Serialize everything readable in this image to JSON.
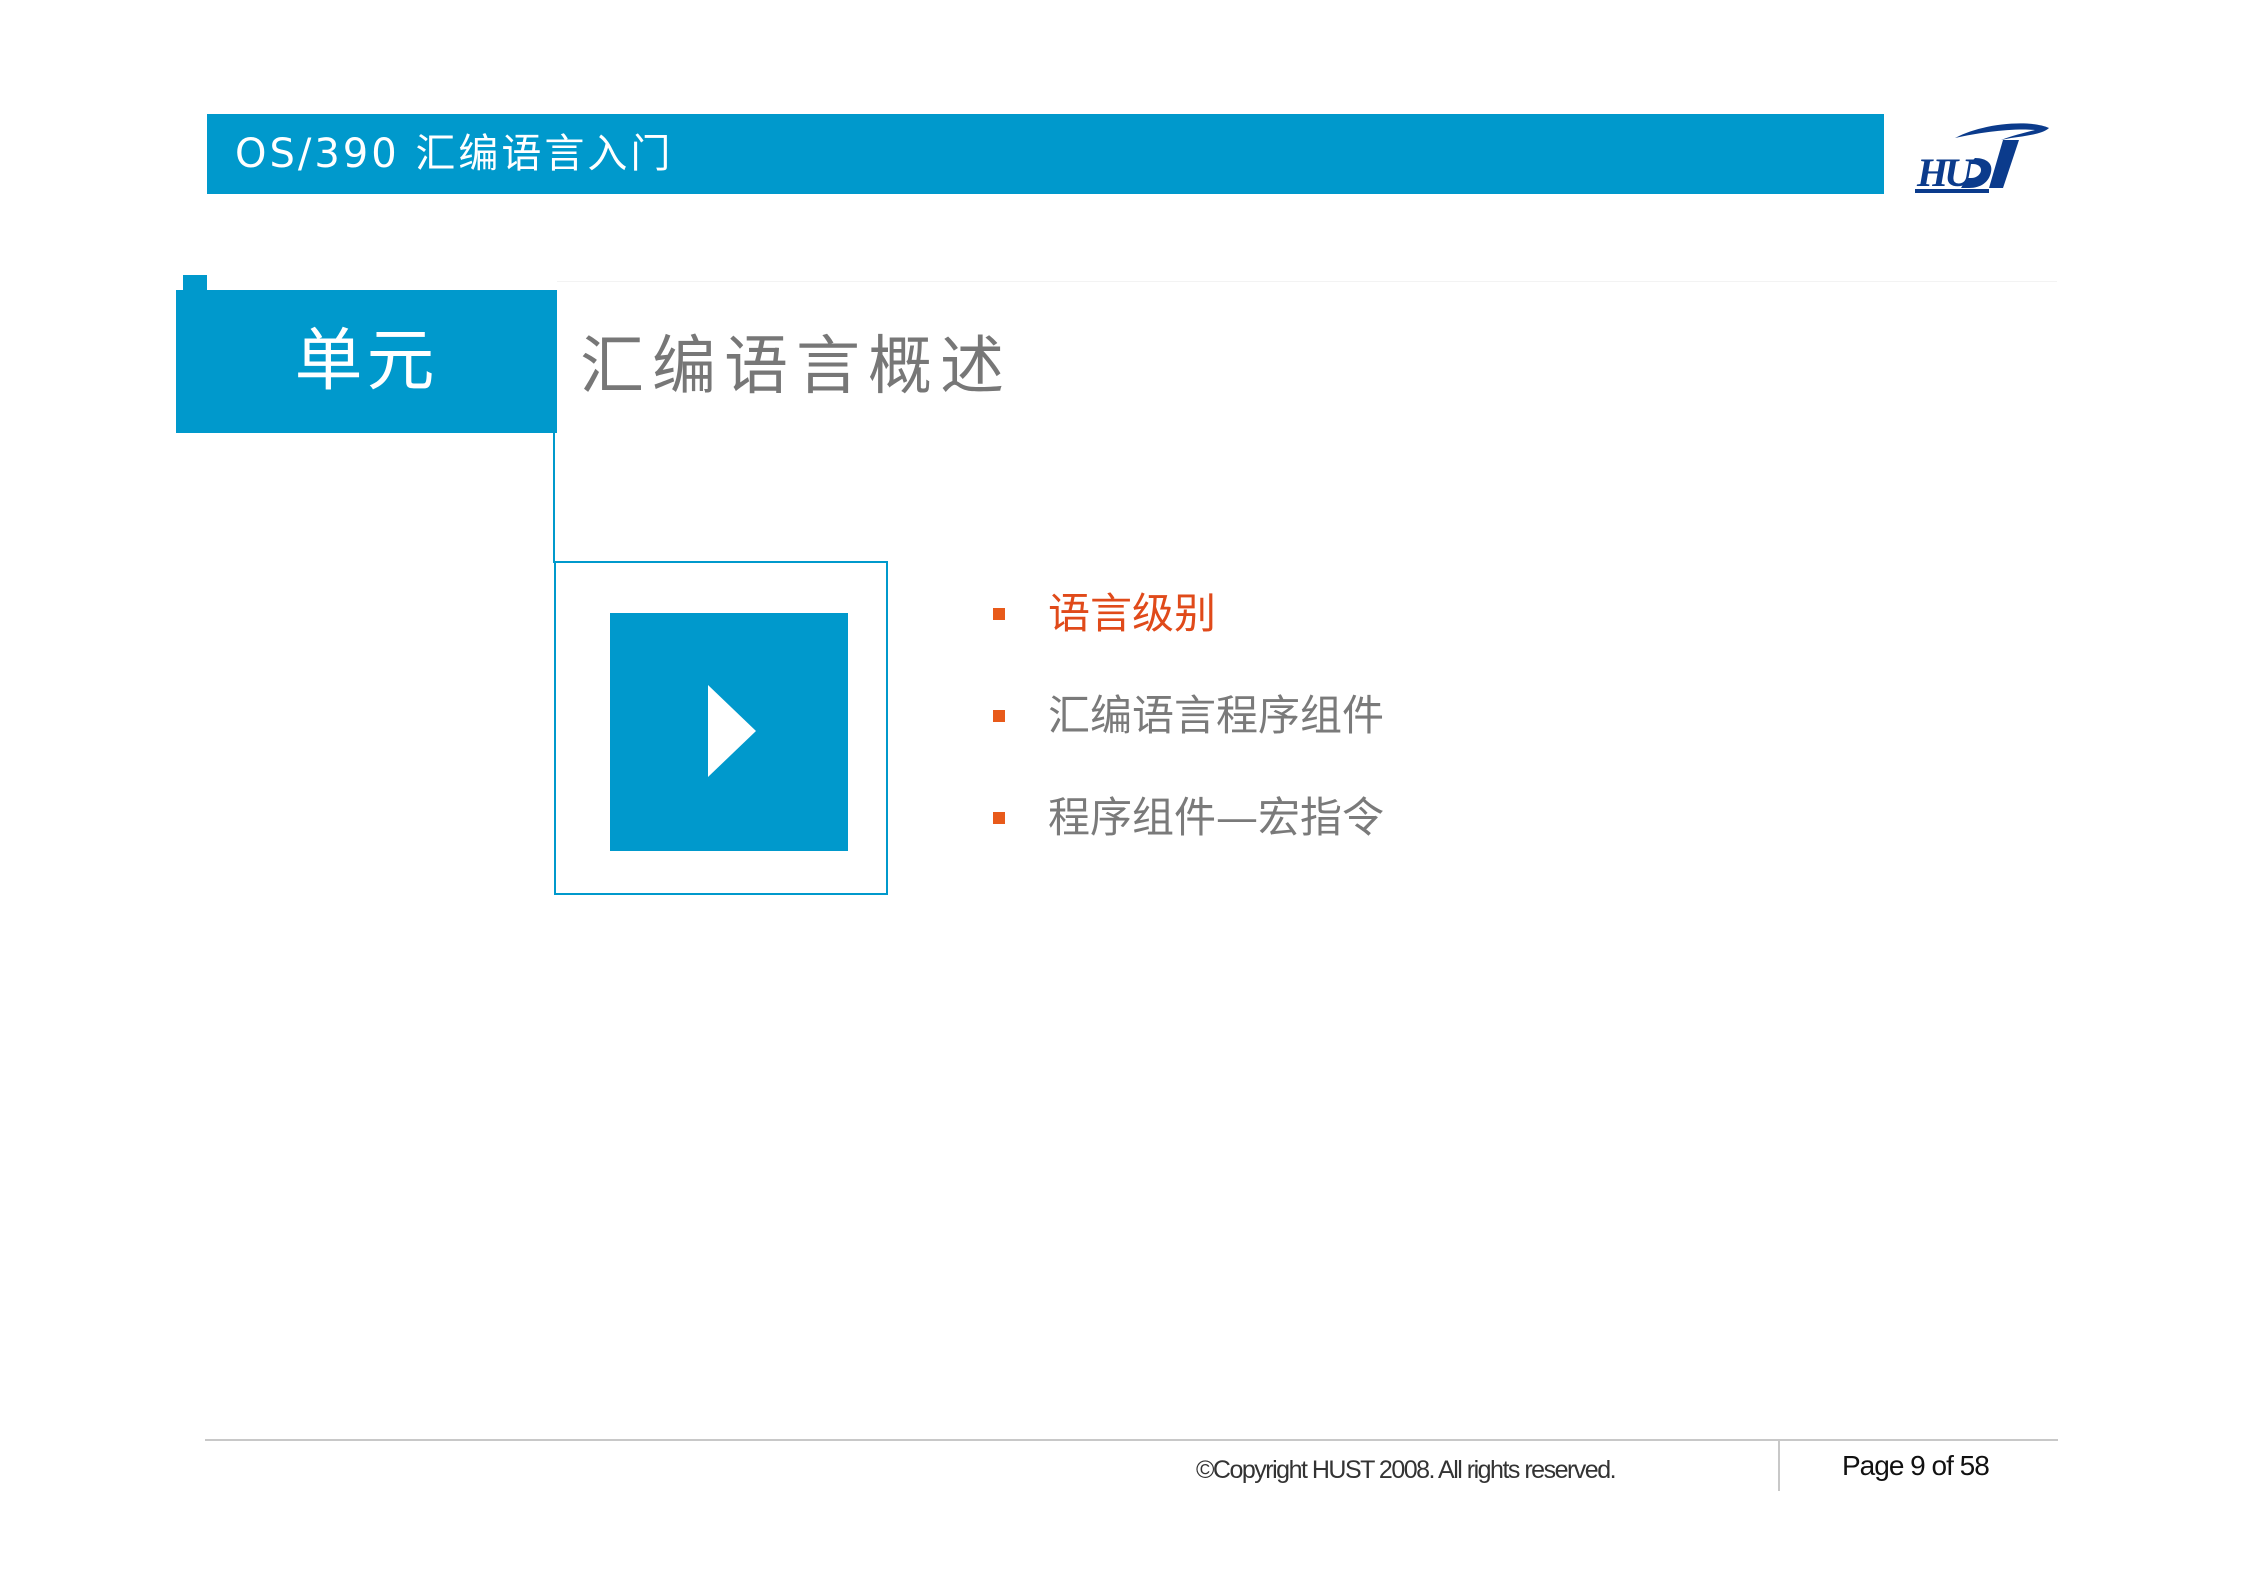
{
  "header": {
    "title": "OS/390 汇编语言入门"
  },
  "logo": {
    "name": "hust-logo",
    "text": "HUST",
    "color": "#0b3b8c"
  },
  "unit": {
    "label": "单元",
    "title": "汇编语言概述"
  },
  "play_icon": "play-icon",
  "bullets": [
    {
      "text": "语言级别",
      "active": true
    },
    {
      "text": "汇编语言程序组件",
      "active": false
    },
    {
      "text": "程序组件—宏指令",
      "active": false
    }
  ],
  "footer": {
    "copyright": "©Copyright HUST 2008. All rights reserved.",
    "page": "Page 9 of 58"
  },
  "colors": {
    "accent": "#0099cc",
    "bullet_marker": "#e85a1a",
    "active_text": "#e04a1a",
    "muted_text": "#7a7a7a"
  }
}
